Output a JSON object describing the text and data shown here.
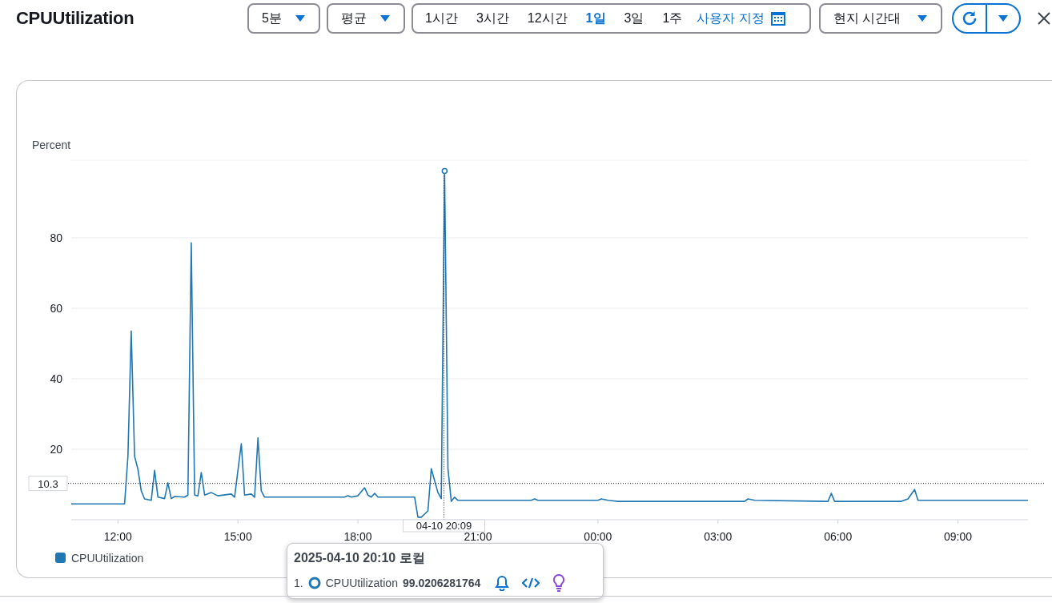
{
  "title": "CPUUtilization",
  "controls": {
    "period": "5분",
    "statistic": "평균",
    "time_ranges": [
      {
        "label": "1시간",
        "selected": false
      },
      {
        "label": "3시간",
        "selected": false
      },
      {
        "label": "12시간",
        "selected": false
      },
      {
        "label": "1일",
        "selected": true
      },
      {
        "label": "3일",
        "selected": false
      },
      {
        "label": "1주",
        "selected": false
      }
    ],
    "custom_range": "사용자 지정",
    "timezone": "현지 시간대"
  },
  "chart": {
    "chart_data": {
      "type": "line",
      "ylabel": "Percent",
      "grid": true,
      "x": [
        "2025-04-10T10:50",
        "2025-04-10T12:10",
        "2025-04-10T12:15",
        "2025-04-10T12:20",
        "2025-04-10T12:25",
        "2025-04-10T12:30",
        "2025-04-10T12:35",
        "2025-04-10T12:40",
        "2025-04-10T12:50",
        "2025-04-10T12:55",
        "2025-04-10T13:00",
        "2025-04-10T13:10",
        "2025-04-10T13:15",
        "2025-04-10T13:20",
        "2025-04-10T13:25",
        "2025-04-10T13:40",
        "2025-04-10T13:45",
        "2025-04-10T13:50",
        "2025-04-10T13:55",
        "2025-04-10T14:00",
        "2025-04-10T14:05",
        "2025-04-10T14:10",
        "2025-04-10T14:20",
        "2025-04-10T14:30",
        "2025-04-10T14:50",
        "2025-04-10T14:55",
        "2025-04-10T15:05",
        "2025-04-10T15:10",
        "2025-04-10T15:20",
        "2025-04-10T15:25",
        "2025-04-10T15:30",
        "2025-04-10T15:35",
        "2025-04-10T15:40",
        "2025-04-10T17:40",
        "2025-04-10T17:45",
        "2025-04-10T17:50",
        "2025-04-10T18:00",
        "2025-04-10T18:10",
        "2025-04-10T18:15",
        "2025-04-10T18:20",
        "2025-04-10T18:25",
        "2025-04-10T18:30",
        "2025-04-10T19:25",
        "2025-04-10T19:30",
        "2025-04-10T19:35",
        "2025-04-10T19:45",
        "2025-04-10T19:50",
        "2025-04-10T20:00",
        "2025-04-10T20:05",
        "2025-04-10T20:10",
        "2025-04-10T20:15",
        "2025-04-10T20:20",
        "2025-04-10T20:25",
        "2025-04-10T20:30",
        "2025-04-10T22:20",
        "2025-04-10T22:25",
        "2025-04-10T22:30",
        "2025-04-11T00:00",
        "2025-04-11T00:05",
        "2025-04-11T00:15",
        "2025-04-11T00:30",
        "2025-04-11T03:40",
        "2025-04-11T03:45",
        "2025-04-11T03:55",
        "2025-04-11T05:45",
        "2025-04-11T05:50",
        "2025-04-11T05:55",
        "2025-04-11T07:35",
        "2025-04-11T07:45",
        "2025-04-11T07:55",
        "2025-04-11T08:00",
        "2025-04-11T10:45"
      ],
      "series": [
        {
          "name": "CPUUtilization",
          "color": "#1f77b4",
          "values": [
            4.5,
            4.5,
            18,
            53.6,
            18,
            14.3,
            8.2,
            5.9,
            5.5,
            14,
            6.4,
            6,
            10.5,
            6,
            6.6,
            6.4,
            7,
            78.6,
            7,
            6.8,
            13.4,
            7,
            7.7,
            6.8,
            7.3,
            6.4,
            21.6,
            7,
            7.3,
            6.4,
            23.2,
            8.2,
            6.4,
            6.4,
            6.8,
            6.4,
            6.8,
            9.1,
            7,
            6.4,
            7.5,
            6.4,
            6.4,
            0.7,
            0.7,
            2.5,
            14.5,
            7.7,
            6,
            99,
            14.5,
            5.2,
            6.4,
            5.5,
            5.5,
            5.9,
            5.5,
            5.5,
            5.9,
            5.5,
            5.2,
            5.2,
            5.9,
            5.5,
            5.2,
            7.5,
            5.2,
            5.2,
            5.9,
            8.6,
            5.5,
            5.5
          ]
        }
      ],
      "xlim": [
        "2025-04-10T10:50",
        "2025-04-11T10:45"
      ],
      "xticks": [
        {
          "value": "2025-04-10T12:00",
          "label": "12:00"
        },
        {
          "value": "2025-04-10T15:00",
          "label": "15:00"
        },
        {
          "value": "2025-04-10T18:00",
          "label": "18:00"
        },
        {
          "value": "2025-04-10T21:00",
          "label": "21:00"
        },
        {
          "value": "2025-04-11T00:00",
          "label": "00:00"
        },
        {
          "value": "2025-04-11T03:00",
          "label": "03:00"
        },
        {
          "value": "2025-04-11T06:00",
          "label": "06:00"
        },
        {
          "value": "2025-04-11T09:00",
          "label": "09:00"
        }
      ],
      "yticks": [
        20,
        40,
        60,
        80
      ],
      "ylim": [
        0,
        102
      ],
      "ref_lines": [
        {
          "axis": "y",
          "value": 10.3,
          "label": "10.3"
        },
        {
          "axis": "x",
          "value": "2025-04-10T20:09",
          "label": "04-10 20:09"
        }
      ]
    }
  },
  "tooltip": {
    "title": "2025-04-10 20:10 로컬",
    "rows": [
      {
        "index": "1.",
        "name": "CPUUtilization",
        "value": "99.0206281764"
      }
    ]
  }
}
